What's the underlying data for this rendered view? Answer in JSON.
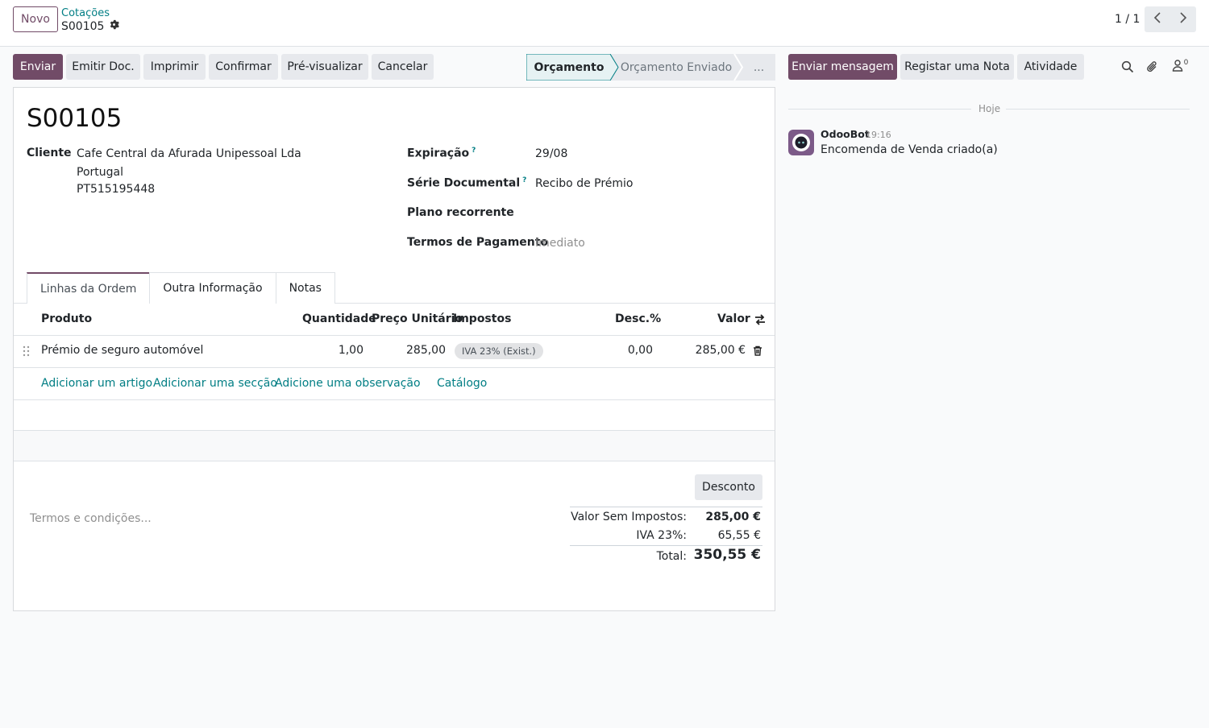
{
  "control_panel": {
    "new_button": "Novo",
    "breadcrumb_parent": "Cotações",
    "breadcrumb_current": "S00105",
    "pager": "1 / 1"
  },
  "actions": {
    "send": "Enviar",
    "emit_doc": "Emitir Doc.",
    "print": "Imprimir",
    "confirm": "Confirmar",
    "preview": "Pré-visualizar",
    "cancel": "Cancelar"
  },
  "statusbar": {
    "active": "Orçamento",
    "sent": "Orçamento Enviado",
    "more": "..."
  },
  "form": {
    "title": "S00105",
    "customer_label": "Cliente",
    "customer_line1": "Cafe Central da Afurada Unipessoal Lda",
    "customer_line2": "Portugal",
    "customer_line3": "PT515195448",
    "expiration_label": "Expiração",
    "expiration_value": "29/08",
    "series_label": "Série Documental",
    "series_value": "Recibo de Prémio",
    "recurring_label": "Plano recorrente",
    "payment_terms_label": "Termos de Pagamento",
    "payment_terms_value": "Imediato",
    "help_mark": "?"
  },
  "tabs": {
    "order_lines": "Linhas da Ordem",
    "other_info": "Outra Informação",
    "notes": "Notas"
  },
  "table": {
    "headers": {
      "product": "Produto",
      "quantity": "Quantidade",
      "unit_price": "Preço Unitário",
      "taxes": "Impostos",
      "discount": "Desc.%",
      "amount": "Valor"
    },
    "rows": [
      {
        "product": "Prémio de seguro automóvel",
        "quantity": "1,00",
        "unit_price": "285,00",
        "tax": "IVA 23% (Exist.)",
        "discount": "0,00",
        "amount": "285,00 €"
      }
    ],
    "add_product": "Adicionar um artigo",
    "add_section": "Adicionar uma secção",
    "add_note": "Adicione uma observação",
    "catalog": "Catálogo"
  },
  "totals": {
    "discount_button": "Desconto",
    "terms_placeholder": "Termos e condições...",
    "untaxed_label": "Valor Sem Impostos:",
    "untaxed_value": "285,00 €",
    "vat_label": "IVA 23%:",
    "vat_value": "65,55 €",
    "total_label": "Total:",
    "total_value": "350,55 €"
  },
  "chatter": {
    "send_message": "Enviar mensagem",
    "log_note": "Registar uma Nota",
    "activity": "Atividade",
    "followers_count": "0",
    "date_separator": "Hoje",
    "messages": [
      {
        "author": "OdooBot",
        "time": "19:16",
        "body": "Encomenda de Venda criado(a)"
      }
    ]
  },
  "colors": {
    "primary": "#714b67",
    "link": "#017e84"
  }
}
